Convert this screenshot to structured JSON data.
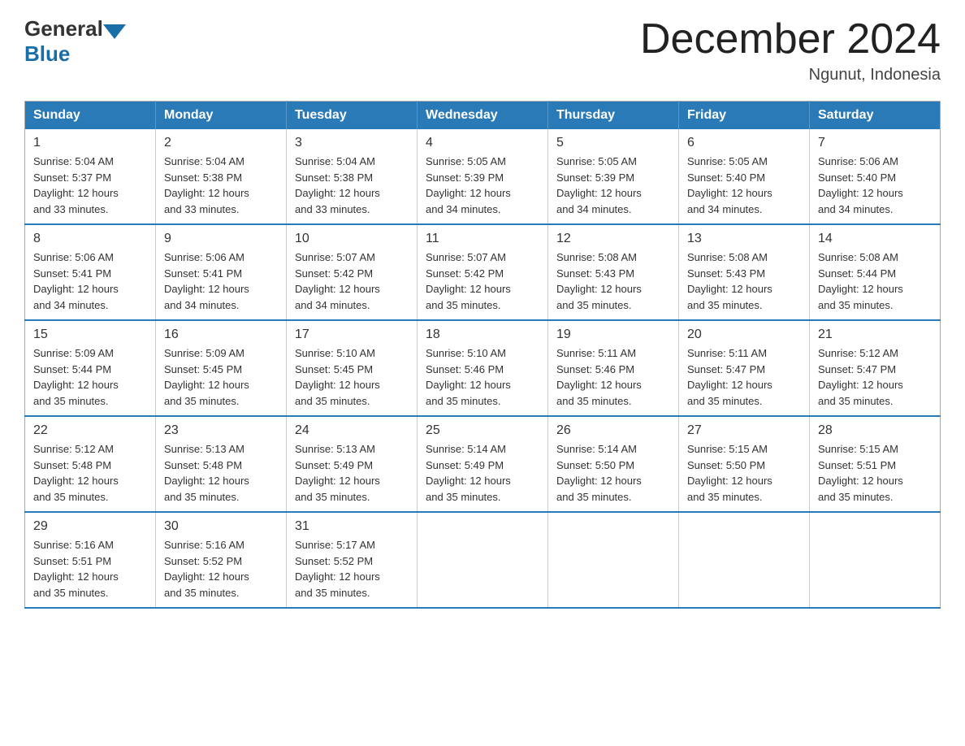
{
  "logo": {
    "general": "General",
    "blue": "Blue"
  },
  "title": {
    "month": "December 2024",
    "location": "Ngunut, Indonesia"
  },
  "header_days": [
    "Sunday",
    "Monday",
    "Tuesday",
    "Wednesday",
    "Thursday",
    "Friday",
    "Saturday"
  ],
  "weeks": [
    [
      {
        "day": "1",
        "sunrise": "5:04 AM",
        "sunset": "5:37 PM",
        "daylight": "12 hours and 33 minutes."
      },
      {
        "day": "2",
        "sunrise": "5:04 AM",
        "sunset": "5:38 PM",
        "daylight": "12 hours and 33 minutes."
      },
      {
        "day": "3",
        "sunrise": "5:04 AM",
        "sunset": "5:38 PM",
        "daylight": "12 hours and 33 minutes."
      },
      {
        "day": "4",
        "sunrise": "5:05 AM",
        "sunset": "5:39 PM",
        "daylight": "12 hours and 34 minutes."
      },
      {
        "day": "5",
        "sunrise": "5:05 AM",
        "sunset": "5:39 PM",
        "daylight": "12 hours and 34 minutes."
      },
      {
        "day": "6",
        "sunrise": "5:05 AM",
        "sunset": "5:40 PM",
        "daylight": "12 hours and 34 minutes."
      },
      {
        "day": "7",
        "sunrise": "5:06 AM",
        "sunset": "5:40 PM",
        "daylight": "12 hours and 34 minutes."
      }
    ],
    [
      {
        "day": "8",
        "sunrise": "5:06 AM",
        "sunset": "5:41 PM",
        "daylight": "12 hours and 34 minutes."
      },
      {
        "day": "9",
        "sunrise": "5:06 AM",
        "sunset": "5:41 PM",
        "daylight": "12 hours and 34 minutes."
      },
      {
        "day": "10",
        "sunrise": "5:07 AM",
        "sunset": "5:42 PM",
        "daylight": "12 hours and 34 minutes."
      },
      {
        "day": "11",
        "sunrise": "5:07 AM",
        "sunset": "5:42 PM",
        "daylight": "12 hours and 35 minutes."
      },
      {
        "day": "12",
        "sunrise": "5:08 AM",
        "sunset": "5:43 PM",
        "daylight": "12 hours and 35 minutes."
      },
      {
        "day": "13",
        "sunrise": "5:08 AM",
        "sunset": "5:43 PM",
        "daylight": "12 hours and 35 minutes."
      },
      {
        "day": "14",
        "sunrise": "5:08 AM",
        "sunset": "5:44 PM",
        "daylight": "12 hours and 35 minutes."
      }
    ],
    [
      {
        "day": "15",
        "sunrise": "5:09 AM",
        "sunset": "5:44 PM",
        "daylight": "12 hours and 35 minutes."
      },
      {
        "day": "16",
        "sunrise": "5:09 AM",
        "sunset": "5:45 PM",
        "daylight": "12 hours and 35 minutes."
      },
      {
        "day": "17",
        "sunrise": "5:10 AM",
        "sunset": "5:45 PM",
        "daylight": "12 hours and 35 minutes."
      },
      {
        "day": "18",
        "sunrise": "5:10 AM",
        "sunset": "5:46 PM",
        "daylight": "12 hours and 35 minutes."
      },
      {
        "day": "19",
        "sunrise": "5:11 AM",
        "sunset": "5:46 PM",
        "daylight": "12 hours and 35 minutes."
      },
      {
        "day": "20",
        "sunrise": "5:11 AM",
        "sunset": "5:47 PM",
        "daylight": "12 hours and 35 minutes."
      },
      {
        "day": "21",
        "sunrise": "5:12 AM",
        "sunset": "5:47 PM",
        "daylight": "12 hours and 35 minutes."
      }
    ],
    [
      {
        "day": "22",
        "sunrise": "5:12 AM",
        "sunset": "5:48 PM",
        "daylight": "12 hours and 35 minutes."
      },
      {
        "day": "23",
        "sunrise": "5:13 AM",
        "sunset": "5:48 PM",
        "daylight": "12 hours and 35 minutes."
      },
      {
        "day": "24",
        "sunrise": "5:13 AM",
        "sunset": "5:49 PM",
        "daylight": "12 hours and 35 minutes."
      },
      {
        "day": "25",
        "sunrise": "5:14 AM",
        "sunset": "5:49 PM",
        "daylight": "12 hours and 35 minutes."
      },
      {
        "day": "26",
        "sunrise": "5:14 AM",
        "sunset": "5:50 PM",
        "daylight": "12 hours and 35 minutes."
      },
      {
        "day": "27",
        "sunrise": "5:15 AM",
        "sunset": "5:50 PM",
        "daylight": "12 hours and 35 minutes."
      },
      {
        "day": "28",
        "sunrise": "5:15 AM",
        "sunset": "5:51 PM",
        "daylight": "12 hours and 35 minutes."
      }
    ],
    [
      {
        "day": "29",
        "sunrise": "5:16 AM",
        "sunset": "5:51 PM",
        "daylight": "12 hours and 35 minutes."
      },
      {
        "day": "30",
        "sunrise": "5:16 AM",
        "sunset": "5:52 PM",
        "daylight": "12 hours and 35 minutes."
      },
      {
        "day": "31",
        "sunrise": "5:17 AM",
        "sunset": "5:52 PM",
        "daylight": "12 hours and 35 minutes."
      },
      null,
      null,
      null,
      null
    ]
  ],
  "labels": {
    "sunrise": "Sunrise:",
    "sunset": "Sunset:",
    "daylight": "Daylight:"
  }
}
